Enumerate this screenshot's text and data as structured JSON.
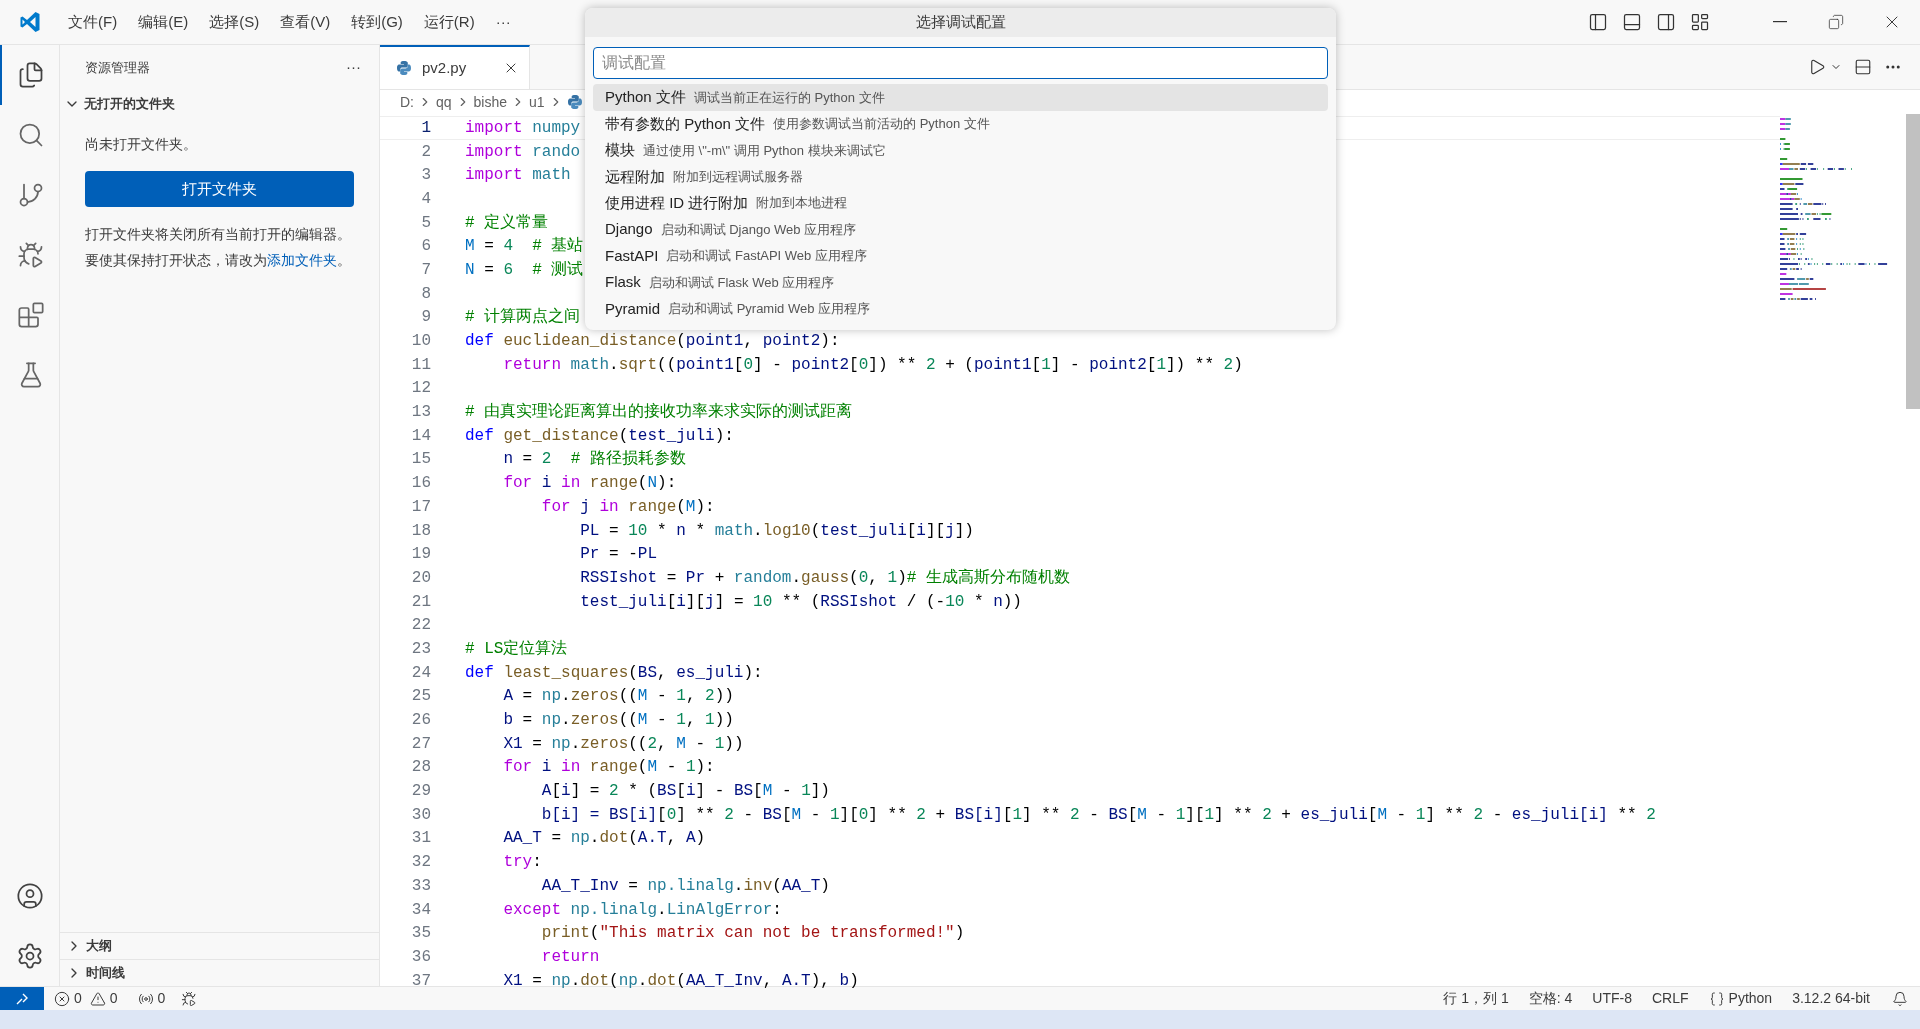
{
  "title_bar": {
    "menus": [
      "文件(F)",
      "编辑(E)",
      "选择(S)",
      "查看(V)",
      "转到(G)",
      "运行(R)",
      "···"
    ]
  },
  "activity_bar": {
    "items": [
      {
        "kind": "files",
        "selected": true
      },
      {
        "kind": "search",
        "selected": false
      },
      {
        "kind": "branch",
        "selected": false
      },
      {
        "kind": "debug",
        "selected": false
      },
      {
        "kind": "extensions",
        "selected": false
      },
      {
        "kind": "flask",
        "selected": false
      }
    ],
    "bottom": [
      {
        "kind": "account"
      },
      {
        "kind": "settings"
      }
    ]
  },
  "sidebar": {
    "title": "资源管理器",
    "more": "···",
    "section": {
      "title": "无打开的文件夹",
      "expanded": true,
      "message": "尚未打开文件夹。",
      "button": "打开文件夹",
      "note": "打开文件夹将关闭所有当前打开的编辑器。要使其保持打开状态，请改为",
      "link": "添加文件夹",
      "note_end": "。"
    },
    "bottom_sections": [
      {
        "title": "大纲",
        "expanded": false
      },
      {
        "title": "时间线",
        "expanded": false
      }
    ]
  },
  "editor": {
    "tabs": [
      {
        "label": "pv2.py",
        "selected": true
      }
    ],
    "breadcrumb": [
      "D:",
      "qq",
      "bishe",
      "u1"
    ],
    "lines": [
      {
        "number": "1",
        "current": true,
        "tokens": [
          {
            "kind": "kw",
            "text": "import"
          },
          {
            "kind": "mod",
            "text": " numpy"
          }
        ]
      },
      {
        "number": "2",
        "current": false,
        "tokens": [
          {
            "kind": "kw",
            "text": "import"
          },
          {
            "kind": "mod",
            "text": " rando"
          }
        ]
      },
      {
        "number": "3",
        "current": false,
        "tokens": [
          {
            "kind": "kw",
            "text": "import"
          },
          {
            "kind": "mod",
            "text": " math"
          }
        ]
      },
      {
        "number": "4",
        "current": false
      },
      {
        "number": "5",
        "current": false,
        "tokens": [
          {
            "kind": "com",
            "text": "# 定义常量"
          }
        ]
      },
      {
        "number": "6",
        "current": false,
        "tokens": [
          {
            "kind": "const",
            "text": "M"
          },
          {
            "kind": "p",
            "text": " = "
          },
          {
            "kind": "num",
            "text": "4"
          },
          {
            "kind": "com",
            "text": "  # 基站"
          }
        ]
      },
      {
        "number": "7",
        "current": false,
        "tokens": [
          {
            "kind": "const",
            "text": "N"
          },
          {
            "kind": "p",
            "text": " = "
          },
          {
            "kind": "num",
            "text": "6"
          },
          {
            "kind": "com",
            "text": "  # 测试"
          }
        ]
      },
      {
        "number": "8",
        "current": false
      },
      {
        "number": "9",
        "current": false,
        "tokens": [
          {
            "kind": "com",
            "text": "# 计算两点之间"
          }
        ]
      },
      {
        "number": "10",
        "current": false,
        "tokens": [
          {
            "kind": "def",
            "text": "def"
          },
          {
            "kind": "fn",
            "text": " euclidean_distance"
          },
          {
            "kind": "p",
            "text": "("
          },
          {
            "kind": "var",
            "text": "point1"
          },
          {
            "kind": "p",
            "text": ", "
          },
          {
            "kind": "var",
            "text": "point2"
          },
          {
            "kind": "p",
            "text": "):"
          }
        ]
      },
      {
        "number": "11",
        "current": false,
        "tokens": [
          {
            "kind": "kw",
            "text": "    return"
          },
          {
            "kind": "mod",
            "text": " math"
          },
          {
            "kind": "p",
            "text": "."
          },
          {
            "kind": "fn",
            "text": "sqrt"
          },
          {
            "kind": "p",
            "text": "(("
          },
          {
            "kind": "var",
            "text": "point1"
          },
          {
            "kind": "p",
            "text": "["
          },
          {
            "kind": "num",
            "text": "0"
          },
          {
            "kind": "p",
            "text": "] - "
          },
          {
            "kind": "var",
            "text": "point2"
          },
          {
            "kind": "p",
            "text": "["
          },
          {
            "kind": "num",
            "text": "0"
          },
          {
            "kind": "p",
            "text": "]) ** "
          },
          {
            "kind": "num",
            "text": "2"
          },
          {
            "kind": "p",
            "text": " + ("
          },
          {
            "kind": "var",
            "text": "point1"
          },
          {
            "kind": "p",
            "text": "["
          },
          {
            "kind": "num",
            "text": "1"
          },
          {
            "kind": "p",
            "text": "] - "
          },
          {
            "kind": "var",
            "text": "point2"
          },
          {
            "kind": "p",
            "text": "["
          },
          {
            "kind": "num",
            "text": "1"
          },
          {
            "kind": "p",
            "text": "]) ** "
          },
          {
            "kind": "num",
            "text": "2"
          },
          {
            "kind": "p",
            "text": ")"
          }
        ]
      },
      {
        "number": "12",
        "current": false
      },
      {
        "number": "13",
        "current": false,
        "tokens": [
          {
            "kind": "com",
            "text": "# 由真实理论距离算出的接收功率来求实际的测试距离"
          }
        ]
      },
      {
        "number": "14",
        "current": false,
        "tokens": [
          {
            "kind": "def",
            "text": "def"
          },
          {
            "kind": "fn",
            "text": " get_distance"
          },
          {
            "kind": "p",
            "text": "("
          },
          {
            "kind": "var",
            "text": "test_juli"
          },
          {
            "kind": "p",
            "text": "):"
          }
        ]
      },
      {
        "number": "15",
        "current": false,
        "tokens": [
          {
            "kind": "var",
            "text": "    n"
          },
          {
            "kind": "p",
            "text": " = "
          },
          {
            "kind": "num",
            "text": "2"
          },
          {
            "kind": "com",
            "text": "  # 路径损耗参数"
          }
        ]
      },
      {
        "number": "16",
        "current": false,
        "tokens": [
          {
            "kind": "kw",
            "text": "    for"
          },
          {
            "kind": "var",
            "text": " i"
          },
          {
            "kind": "kw",
            "text": " in"
          },
          {
            "kind": "fn",
            "text": " range"
          },
          {
            "kind": "p",
            "text": "("
          },
          {
            "kind": "const",
            "text": "N"
          },
          {
            "kind": "p",
            "text": "):"
          }
        ]
      },
      {
        "number": "17",
        "current": false,
        "tokens": [
          {
            "kind": "kw",
            "text": "        for"
          },
          {
            "kind": "var",
            "text": " j"
          },
          {
            "kind": "kw",
            "text": " in"
          },
          {
            "kind": "fn",
            "text": " range"
          },
          {
            "kind": "p",
            "text": "("
          },
          {
            "kind": "const",
            "text": "M"
          },
          {
            "kind": "p",
            "text": "):"
          }
        ]
      },
      {
        "number": "18",
        "current": false,
        "tokens": [
          {
            "kind": "var",
            "text": "            PL"
          },
          {
            "kind": "p",
            "text": " = "
          },
          {
            "kind": "num",
            "text": "10"
          },
          {
            "kind": "p",
            "text": " * "
          },
          {
            "kind": "var",
            "text": "n"
          },
          {
            "kind": "p",
            "text": " * "
          },
          {
            "kind": "mod",
            "text": "math"
          },
          {
            "kind": "p",
            "text": "."
          },
          {
            "kind": "fn",
            "text": "log10"
          },
          {
            "kind": "p",
            "text": "("
          },
          {
            "kind": "var",
            "text": "test_juli"
          },
          {
            "kind": "p",
            "text": "["
          },
          {
            "kind": "var",
            "text": "i"
          },
          {
            "kind": "p",
            "text": "]["
          },
          {
            "kind": "var",
            "text": "j"
          },
          {
            "kind": "p",
            "text": "])"
          }
        ]
      },
      {
        "number": "19",
        "current": false,
        "tokens": [
          {
            "kind": "var",
            "text": "            Pr"
          },
          {
            "kind": "p",
            "text": " = -"
          },
          {
            "kind": "var",
            "text": "PL"
          }
        ]
      },
      {
        "number": "20",
        "current": false,
        "tokens": [
          {
            "kind": "var",
            "text": "            RSSIshot"
          },
          {
            "kind": "p",
            "text": " = "
          },
          {
            "kind": "var",
            "text": "Pr"
          },
          {
            "kind": "p",
            "text": " + "
          },
          {
            "kind": "mod",
            "text": "random"
          },
          {
            "kind": "p",
            "text": "."
          },
          {
            "kind": "fn",
            "text": "gauss"
          },
          {
            "kind": "p",
            "text": "("
          },
          {
            "kind": "num",
            "text": "0"
          },
          {
            "kind": "p",
            "text": ", "
          },
          {
            "kind": "num",
            "text": "1"
          },
          {
            "kind": "p",
            "text": ")"
          },
          {
            "kind": "com",
            "text": "# 生成高斯分布随机数"
          }
        ]
      },
      {
        "number": "21",
        "current": false,
        "tokens": [
          {
            "kind": "var",
            "text": "            test_juli"
          },
          {
            "kind": "p",
            "text": "["
          },
          {
            "kind": "var",
            "text": "i"
          },
          {
            "kind": "p",
            "text": "]["
          },
          {
            "kind": "var",
            "text": "j"
          },
          {
            "kind": "p",
            "text": "] = "
          },
          {
            "kind": "num",
            "text": "10"
          },
          {
            "kind": "p",
            "text": " ** ("
          },
          {
            "kind": "var",
            "text": "RSSIshot"
          },
          {
            "kind": "p",
            "text": " / (-"
          },
          {
            "kind": "num",
            "text": "10"
          },
          {
            "kind": "p",
            "text": " * "
          },
          {
            "kind": "var",
            "text": "n"
          },
          {
            "kind": "p",
            "text": "))"
          }
        ]
      },
      {
        "number": "22",
        "current": false
      },
      {
        "number": "23",
        "current": false,
        "tokens": [
          {
            "kind": "com",
            "text": "# LS定位算法"
          }
        ]
      },
      {
        "number": "24",
        "current": false,
        "tokens": [
          {
            "kind": "def",
            "text": "def"
          },
          {
            "kind": "fn",
            "text": " least_squares"
          },
          {
            "kind": "p",
            "text": "("
          },
          {
            "kind": "var",
            "text": "BS"
          },
          {
            "kind": "p",
            "text": ", "
          },
          {
            "kind": "var",
            "text": "es_juli"
          },
          {
            "kind": "p",
            "text": "):"
          }
        ]
      },
      {
        "number": "25",
        "current": false,
        "tokens": [
          {
            "kind": "var",
            "text": "    A"
          },
          {
            "kind": "p",
            "text": " = "
          },
          {
            "kind": "mod",
            "text": "np"
          },
          {
            "kind": "p",
            "text": "."
          },
          {
            "kind": "fn",
            "text": "zeros"
          },
          {
            "kind": "p",
            "text": "(("
          },
          {
            "kind": "const",
            "text": "M"
          },
          {
            "kind": "p",
            "text": " - "
          },
          {
            "kind": "num",
            "text": "1"
          },
          {
            "kind": "p",
            "text": ", "
          },
          {
            "kind": "num",
            "text": "2"
          },
          {
            "kind": "p",
            "text": "))"
          }
        ]
      },
      {
        "number": "26",
        "current": false,
        "tokens": [
          {
            "kind": "var",
            "text": "    b"
          },
          {
            "kind": "p",
            "text": " = "
          },
          {
            "kind": "mod",
            "text": "np"
          },
          {
            "kind": "p",
            "text": "."
          },
          {
            "kind": "fn",
            "text": "zeros"
          },
          {
            "kind": "p",
            "text": "(("
          },
          {
            "kind": "const",
            "text": "M"
          },
          {
            "kind": "p",
            "text": " - "
          },
          {
            "kind": "num",
            "text": "1"
          },
          {
            "kind": "p",
            "text": ", "
          },
          {
            "kind": "num",
            "text": "1"
          },
          {
            "kind": "p",
            "text": "))"
          }
        ]
      },
      {
        "number": "27",
        "current": false,
        "tokens": [
          {
            "kind": "var",
            "text": "    X1"
          },
          {
            "kind": "p",
            "text": " = "
          },
          {
            "kind": "mod",
            "text": "np"
          },
          {
            "kind": "p",
            "text": "."
          },
          {
            "kind": "fn",
            "text": "zeros"
          },
          {
            "kind": "p",
            "text": "(("
          },
          {
            "kind": "num",
            "text": "2"
          },
          {
            "kind": "p",
            "text": ", "
          },
          {
            "kind": "const",
            "text": "M"
          },
          {
            "kind": "p",
            "text": " - "
          },
          {
            "kind": "num",
            "text": "1"
          },
          {
            "kind": "p",
            "text": "))"
          }
        ]
      },
      {
        "number": "28",
        "current": false,
        "tokens": [
          {
            "kind": "kw",
            "text": "    for"
          },
          {
            "kind": "var",
            "text": " i"
          },
          {
            "kind": "kw",
            "text": " in"
          },
          {
            "kind": "fn",
            "text": " range"
          },
          {
            "kind": "p",
            "text": "("
          },
          {
            "kind": "const",
            "text": "M"
          },
          {
            "kind": "p",
            "text": " - "
          },
          {
            "kind": "num",
            "text": "1"
          },
          {
            "kind": "p",
            "text": "):"
          }
        ]
      },
      {
        "number": "29",
        "current": false,
        "tokens": [
          {
            "kind": "var",
            "text": "        A"
          },
          {
            "kind": "p",
            "text": "["
          },
          {
            "kind": "var",
            "text": "i"
          },
          {
            "kind": "p",
            "text": "] = "
          },
          {
            "kind": "num",
            "text": "2"
          },
          {
            "kind": "p",
            "text": " * ("
          },
          {
            "kind": "var",
            "text": "BS"
          },
          {
            "kind": "p",
            "text": "["
          },
          {
            "kind": "var",
            "text": "i"
          },
          {
            "kind": "p",
            "text": "] - "
          },
          {
            "kind": "var",
            "text": "BS"
          },
          {
            "kind": "p",
            "text": "["
          },
          {
            "kind": "const",
            "text": "M"
          },
          {
            "kind": "p",
            "text": " - "
          },
          {
            "kind": "num",
            "text": "1"
          },
          {
            "kind": "p",
            "text": "])"
          }
        ]
      },
      {
        "number": "30",
        "current": false,
        "tokens": [
          {
            "kind": "var",
            "text": "        b[i] = BS[i]"
          },
          {
            "kind": "p",
            "text": "["
          },
          {
            "kind": "num",
            "text": "0"
          },
          {
            "kind": "p",
            "text": "] ** "
          },
          {
            "kind": "num",
            "text": "2"
          },
          {
            "kind": "p",
            "text": " - "
          },
          {
            "kind": "var",
            "text": "BS"
          },
          {
            "kind": "p",
            "text": "["
          },
          {
            "kind": "const",
            "text": "M"
          },
          {
            "kind": "p",
            "text": " - "
          },
          {
            "kind": "num",
            "text": "1"
          },
          {
            "kind": "p",
            "text": "]["
          },
          {
            "kind": "num",
            "text": "0"
          },
          {
            "kind": "p",
            "text": "] ** "
          },
          {
            "kind": "num",
            "text": "2"
          },
          {
            "kind": "p",
            "text": " + "
          },
          {
            "kind": "var",
            "text": "BS[i]"
          },
          {
            "kind": "p",
            "text": "["
          },
          {
            "kind": "num",
            "text": "1"
          },
          {
            "kind": "p",
            "text": "] ** "
          },
          {
            "kind": "num",
            "text": "2"
          },
          {
            "kind": "p",
            "text": " - "
          },
          {
            "kind": "var",
            "text": "BS"
          },
          {
            "kind": "p",
            "text": "["
          },
          {
            "kind": "const",
            "text": "M"
          },
          {
            "kind": "p",
            "text": " - "
          },
          {
            "kind": "num",
            "text": "1"
          },
          {
            "kind": "p",
            "text": "]["
          },
          {
            "kind": "num",
            "text": "1"
          },
          {
            "kind": "p",
            "text": "] ** "
          },
          {
            "kind": "num",
            "text": "2"
          },
          {
            "kind": "p",
            "text": " + "
          },
          {
            "kind": "var",
            "text": "es_juli"
          },
          {
            "kind": "p",
            "text": "["
          },
          {
            "kind": "const",
            "text": "M"
          },
          {
            "kind": "p",
            "text": " - "
          },
          {
            "kind": "num",
            "text": "1"
          },
          {
            "kind": "p",
            "text": "] ** "
          },
          {
            "kind": "num",
            "text": "2"
          },
          {
            "kind": "p",
            "text": " - "
          },
          {
            "kind": "var",
            "text": "es_juli[i]"
          },
          {
            "kind": "p",
            "text": " ** "
          },
          {
            "kind": "num",
            "text": "2"
          }
        ]
      },
      {
        "number": "31",
        "current": false,
        "tokens": [
          {
            "kind": "var",
            "text": "    AA_T"
          },
          {
            "kind": "p",
            "text": " = "
          },
          {
            "kind": "mod",
            "text": "np"
          },
          {
            "kind": "p",
            "text": "."
          },
          {
            "kind": "fn",
            "text": "dot"
          },
          {
            "kind": "p",
            "text": "("
          },
          {
            "kind": "var",
            "text": "A.T"
          },
          {
            "kind": "p",
            "text": ", "
          },
          {
            "kind": "var",
            "text": "A"
          },
          {
            "kind": "p",
            "text": ")"
          }
        ]
      },
      {
        "number": "32",
        "current": false,
        "tokens": [
          {
            "kind": "kw",
            "text": "    try"
          },
          {
            "kind": "p",
            "text": ":"
          }
        ]
      },
      {
        "number": "33",
        "current": false,
        "tokens": [
          {
            "kind": "var",
            "text": "        AA_T_Inv"
          },
          {
            "kind": "p",
            "text": " = "
          },
          {
            "kind": "mod",
            "text": "np.linalg"
          },
          {
            "kind": "p",
            "text": "."
          },
          {
            "kind": "fn",
            "text": "inv"
          },
          {
            "kind": "p",
            "text": "("
          },
          {
            "kind": "var",
            "text": "AA_T"
          },
          {
            "kind": "p",
            "text": ")"
          }
        ]
      },
      {
        "number": "34",
        "current": false,
        "tokens": [
          {
            "kind": "kw",
            "text": "    except"
          },
          {
            "kind": "mod",
            "text": " np.linalg"
          },
          {
            "kind": "p",
            "text": "."
          },
          {
            "kind": "cls",
            "text": "LinAlgError"
          },
          {
            "kind": "p",
            "text": ":"
          }
        ]
      },
      {
        "number": "35",
        "current": false,
        "tokens": [
          {
            "kind": "fn",
            "text": "        print"
          },
          {
            "kind": "p",
            "text": "("
          },
          {
            "kind": "str",
            "text": "\"This matrix can not be transformed!\""
          },
          {
            "kind": "p",
            "text": ")"
          }
        ]
      },
      {
        "number": "36",
        "current": false,
        "tokens": [
          {
            "kind": "kw",
            "text": "        return"
          }
        ]
      },
      {
        "number": "37",
        "current": false,
        "tokens": [
          {
            "kind": "var",
            "text": "    X1"
          },
          {
            "kind": "p",
            "text": " = "
          },
          {
            "kind": "mod",
            "text": "np"
          },
          {
            "kind": "p",
            "text": "."
          },
          {
            "kind": "fn",
            "text": "dot"
          },
          {
            "kind": "p",
            "text": "("
          },
          {
            "kind": "mod",
            "text": "np"
          },
          {
            "kind": "p",
            "text": "."
          },
          {
            "kind": "fn",
            "text": "dot"
          },
          {
            "kind": "p",
            "text": "("
          },
          {
            "kind": "var",
            "text": "AA_T_Inv"
          },
          {
            "kind": "p",
            "text": ", "
          },
          {
            "kind": "var",
            "text": "A.T"
          },
          {
            "kind": "p",
            "text": "), "
          },
          {
            "kind": "var",
            "text": "b"
          },
          {
            "kind": "p",
            "text": ")"
          }
        ]
      }
    ]
  },
  "quick_pick": {
    "title": "选择调试配置",
    "placeholder": "调试配置",
    "items": [
      {
        "label": "Python 文件",
        "description": "调试当前正在运行的 Python 文件",
        "selected": true
      },
      {
        "label": "带有参数的 Python 文件",
        "description": "使用参数调试当前活动的 Python 文件",
        "selected": false
      },
      {
        "label": "模块",
        "description": "通过使用 \\\"-m\\\" 调用 Python 模块来调试它",
        "selected": false
      },
      {
        "label": "远程附加",
        "description": "附加到远程调试服务器",
        "selected": false
      },
      {
        "label": "使用进程 ID 进行附加",
        "description": "附加到本地进程",
        "selected": false
      },
      {
        "label": "Django",
        "description": "启动和调试 Django Web 应用程序",
        "selected": false
      },
      {
        "label": "FastAPI",
        "description": "启动和调试 FastAPI Web 应用程序",
        "selected": false
      },
      {
        "label": "Flask",
        "description": "启动和调试 Flask Web 应用程序",
        "selected": false
      },
      {
        "label": "Pyramid",
        "description": "启动和调试 Pyramid Web 应用程序",
        "selected": false
      }
    ]
  },
  "status_bar": {
    "errors": "0",
    "warnings": "0",
    "ports": "0",
    "position": "行 1，列 1",
    "indent": "空格: 4",
    "encoding": "UTF-8",
    "eol": "CRLF",
    "language": "Python",
    "interpreter": "3.12.2 64-bit"
  }
}
